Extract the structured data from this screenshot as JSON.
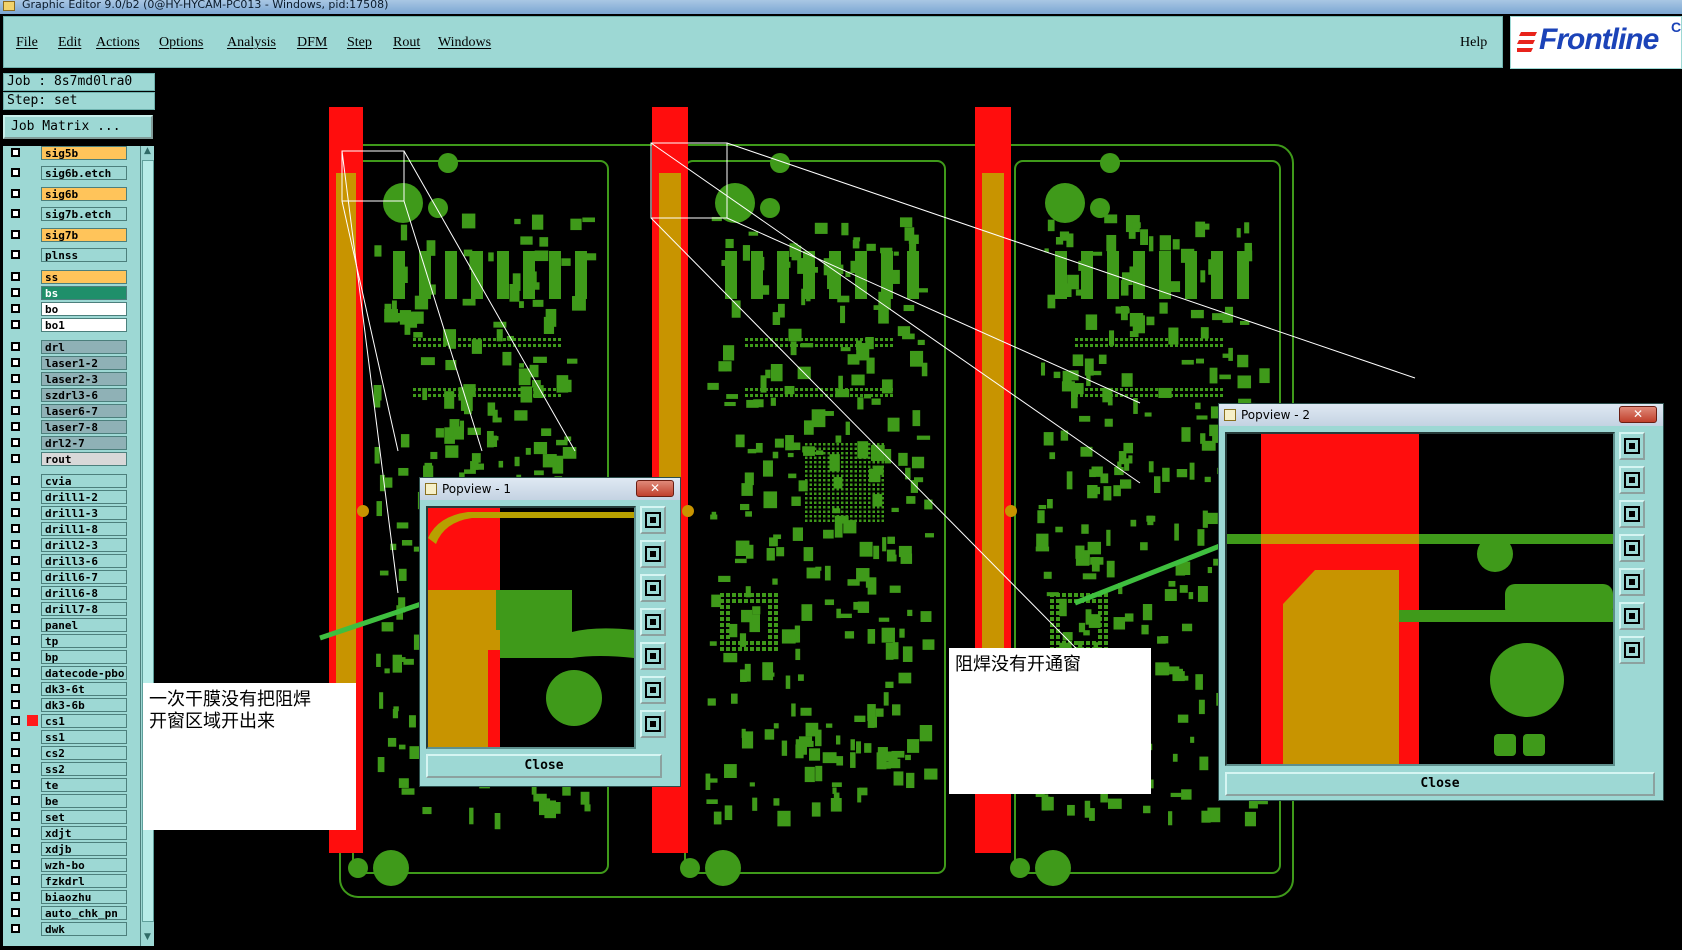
{
  "window": {
    "title": "Graphic Editor 9.0/b2 (0@HY-HYCAM-PC013 - Windows, pid:17508)"
  },
  "menu": {
    "items": [
      "File",
      "Edit",
      "Actions",
      "Options",
      "Analysis",
      "DFM",
      "Step",
      "Rout",
      "Windows"
    ],
    "help": "Help"
  },
  "logo": {
    "text": "Frontline",
    "suffix": "C"
  },
  "info": {
    "job": "Job : 8s7md0lra0",
    "step": "Step: set"
  },
  "job_matrix_label": "Job Matrix ...",
  "layers": [
    {
      "name": "sig5b",
      "color": "#ffc45a"
    },
    {
      "name": "sig6b.etch",
      "color": "#9dd8d4"
    },
    {
      "name": "sig6b",
      "color": "#ffc45a"
    },
    {
      "name": "sig7b.etch",
      "color": "#9dd8d4"
    },
    {
      "name": "sig7b",
      "color": "#ffc45a"
    },
    {
      "name": "plnss",
      "color": "#9dd8d4"
    },
    {
      "name": "ss",
      "color": "#ffc45a"
    },
    {
      "name": "bs",
      "color": "#1f8f6a"
    },
    {
      "name": "bo",
      "color": "#ffffff"
    },
    {
      "name": "bo1",
      "color": "#ffffff"
    },
    {
      "name": "drl",
      "color": "#8fb1b6"
    },
    {
      "name": "laser1-2",
      "color": "#8fb1b6"
    },
    {
      "name": "laser2-3",
      "color": "#8fb1b6"
    },
    {
      "name": "szdrl3-6",
      "color": "#8fb1b6"
    },
    {
      "name": "laser6-7",
      "color": "#8fb1b6"
    },
    {
      "name": "laser7-8",
      "color": "#8fb1b6"
    },
    {
      "name": "drl2-7",
      "color": "#8fb1b6"
    },
    {
      "name": "rout",
      "color": "#d8d8d8"
    },
    {
      "name": "cvia",
      "color": "#9dd8d4"
    },
    {
      "name": "drill1-2",
      "color": "#9dd8d4"
    },
    {
      "name": "drill1-3",
      "color": "#9dd8d4"
    },
    {
      "name": "drill1-8",
      "color": "#9dd8d4"
    },
    {
      "name": "drill2-3",
      "color": "#9dd8d4"
    },
    {
      "name": "drill3-6",
      "color": "#9dd8d4"
    },
    {
      "name": "drill6-7",
      "color": "#9dd8d4"
    },
    {
      "name": "drill6-8",
      "color": "#9dd8d4"
    },
    {
      "name": "drill7-8",
      "color": "#9dd8d4"
    },
    {
      "name": "panel",
      "color": "#9dd8d4"
    },
    {
      "name": "tp",
      "color": "#9dd8d4"
    },
    {
      "name": "bp",
      "color": "#9dd8d4"
    },
    {
      "name": "datecode-pbo",
      "color": "#9dd8d4"
    },
    {
      "name": "dk3-6t",
      "color": "#9dd8d4"
    },
    {
      "name": "dk3-6b",
      "color": "#9dd8d4"
    },
    {
      "name": "cs1",
      "color": "#9dd8d4"
    },
    {
      "name": "ss1",
      "color": "#9dd8d4"
    },
    {
      "name": "cs2",
      "color": "#9dd8d4"
    },
    {
      "name": "ss2",
      "color": "#9dd8d4"
    },
    {
      "name": "te",
      "color": "#9dd8d4"
    },
    {
      "name": "be",
      "color": "#9dd8d4"
    },
    {
      "name": "set",
      "color": "#9dd8d4"
    },
    {
      "name": "xdjt",
      "color": "#9dd8d4"
    },
    {
      "name": "xdjb",
      "color": "#9dd8d4"
    },
    {
      "name": "wzh-bo",
      "color": "#9dd8d4"
    },
    {
      "name": "fzkdrl",
      "color": "#9dd8d4"
    },
    {
      "name": "biaozhu",
      "color": "#9dd8d4"
    },
    {
      "name": "auto_chk_pn",
      "color": "#9dd8d4"
    },
    {
      "name": "dwk",
      "color": "#9dd8d4"
    }
  ],
  "popview1": {
    "title": "Popview - 1",
    "close_label": "Close"
  },
  "popview2": {
    "title": "Popview - 2",
    "close_label": "Close"
  },
  "notes": {
    "left": [
      "一次干膜没有把阻焊",
      "开窗区域开出来"
    ],
    "right": "阻焊没有开通窗"
  },
  "colors": {
    "menu_bg": "#9dd8d4",
    "copper": "#3f9a1a",
    "mask_red": "#ff0d0d",
    "overlap": "#c89400",
    "outline": "#3f9a1a"
  }
}
